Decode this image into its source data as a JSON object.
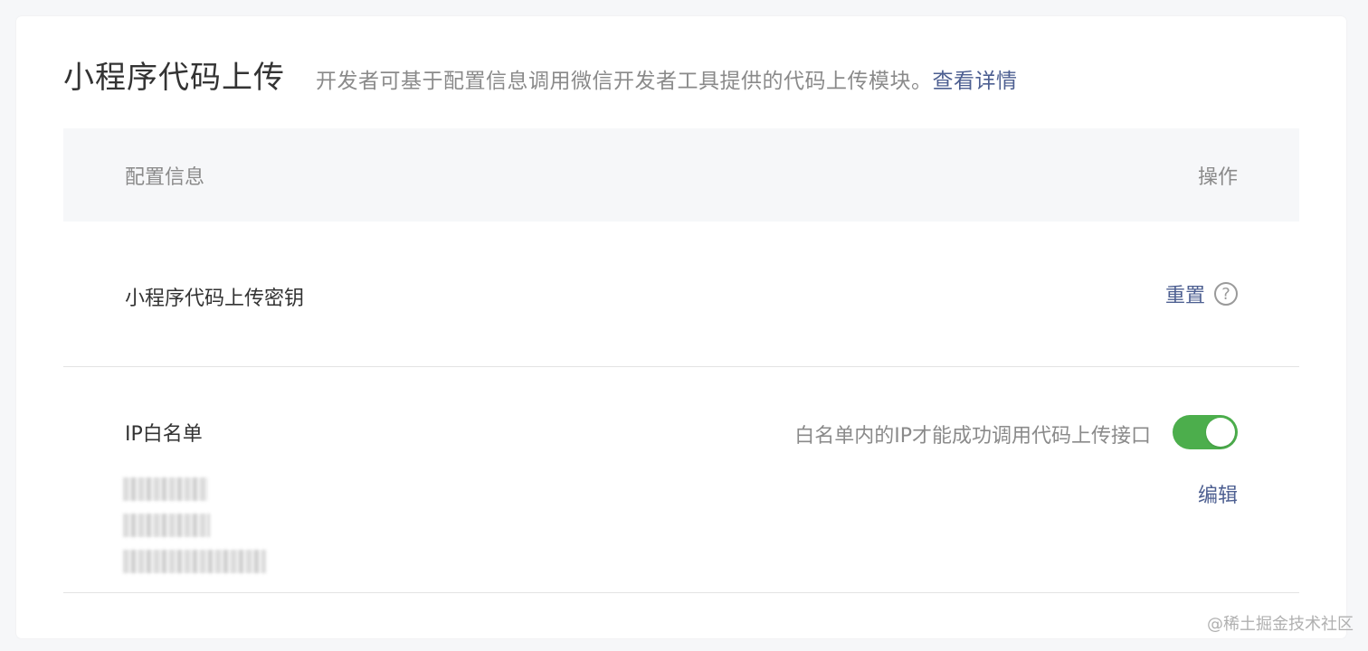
{
  "header": {
    "title": "小程序代码上传",
    "description": "开发者可基于配置信息调用微信开发者工具提供的代码上传模块。",
    "details_link": "查看详情"
  },
  "table": {
    "col_config": "配置信息",
    "col_action": "操作"
  },
  "upload_key": {
    "label": "小程序代码上传密钥",
    "reset_link": "重置",
    "help_icon": "?"
  },
  "ip_whitelist": {
    "label": "IP白名单",
    "hint": "白名单内的IP才能成功调用代码上传接口",
    "enabled": true,
    "edit_link": "编辑"
  },
  "colors": {
    "link": "#4d5f91",
    "toggle_on": "#4cae4c"
  },
  "watermark": "@稀土掘金技术社区"
}
